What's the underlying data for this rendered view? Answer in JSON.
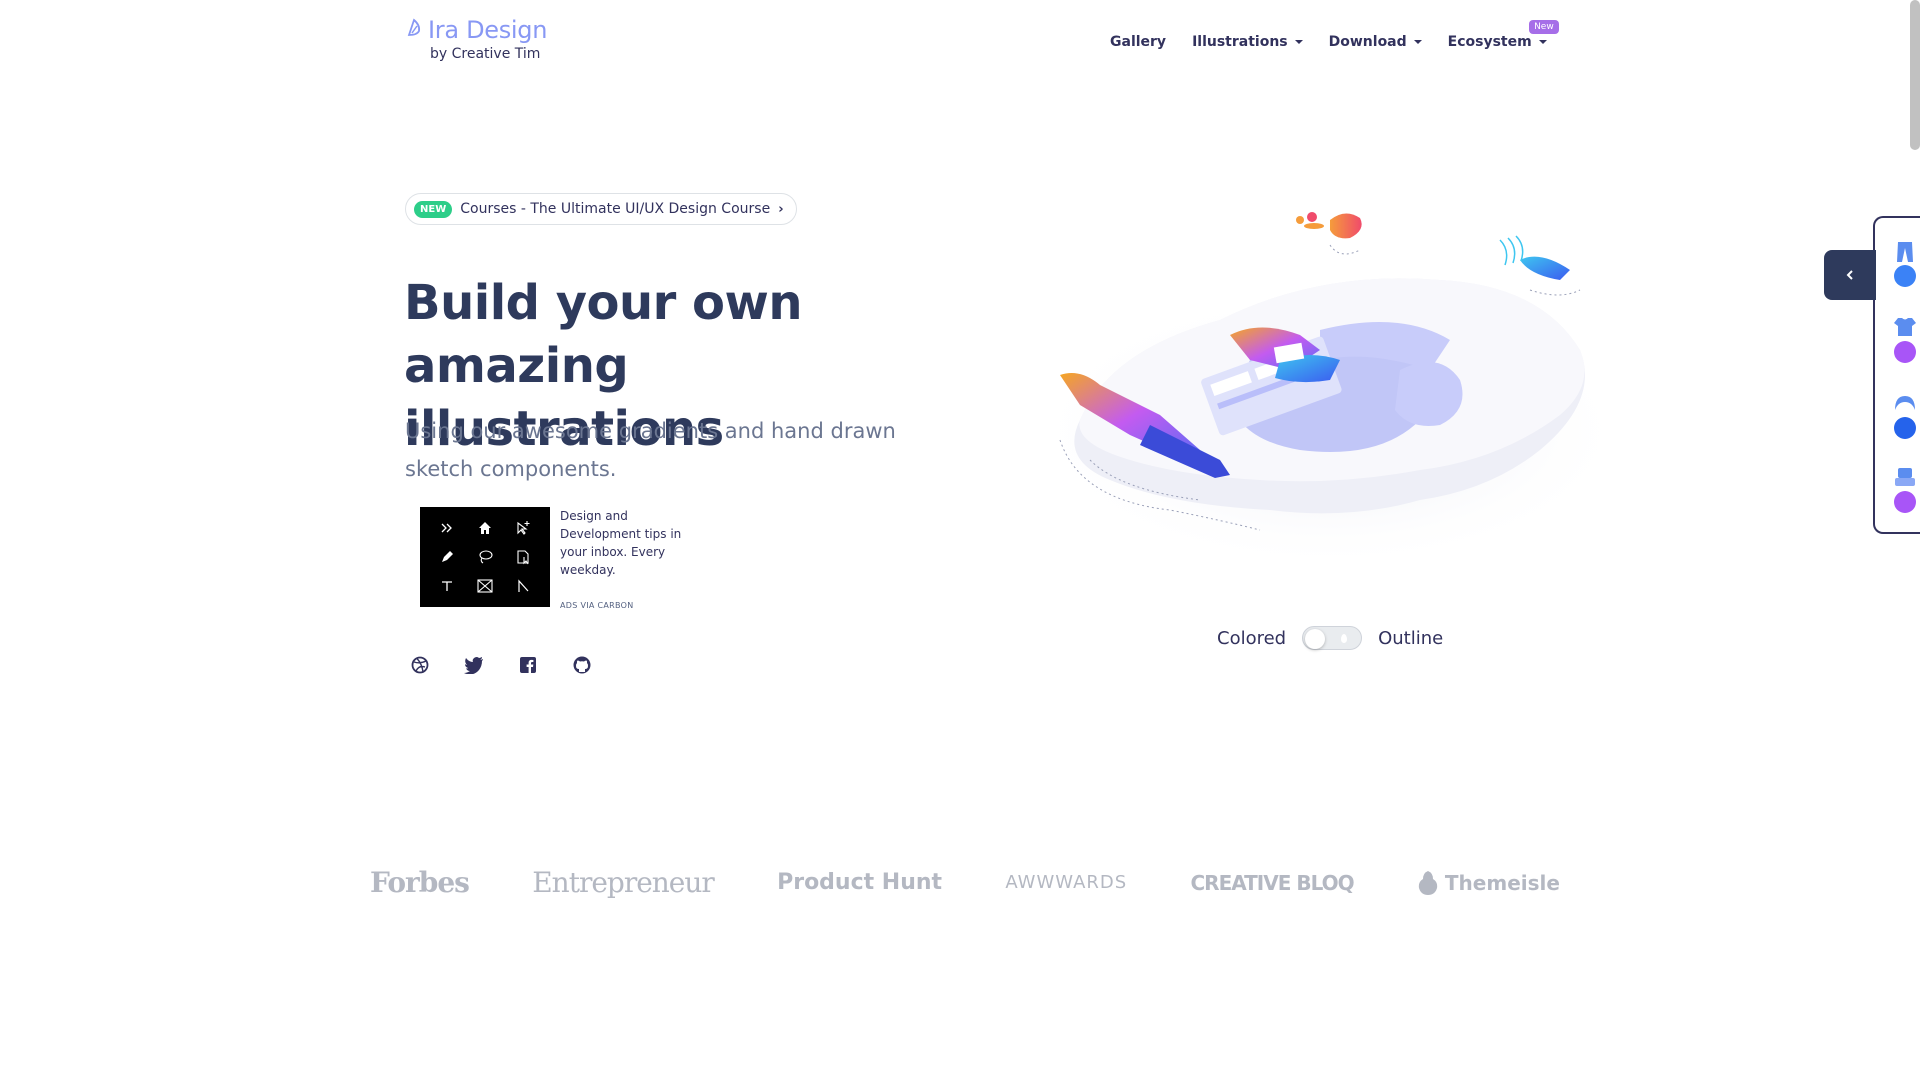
{
  "brand": {
    "title": "Ira Design",
    "subtitle": "by Creative Tim"
  },
  "nav": {
    "items": [
      {
        "label": "Gallery",
        "dropdown": false
      },
      {
        "label": "Illustrations",
        "dropdown": true
      },
      {
        "label": "Download",
        "dropdown": true
      },
      {
        "label": "Ecosystem",
        "dropdown": true,
        "badge": "New"
      }
    ]
  },
  "hero": {
    "pill_badge": "NEW",
    "pill_text": "Courses - The Ultimate UI/UX Design Course",
    "title": "Build your own amazing illustrations",
    "lead": "Using our awesome gradients and hand drawn sketch components."
  },
  "ad": {
    "text": "Design and Development tips in your inbox. Every weekday.",
    "via": "ADS VIA CARBON"
  },
  "social": [
    "dribbble-icon",
    "twitter-icon",
    "facebook-icon",
    "github-icon"
  ],
  "toggle": {
    "left_label": "Colored",
    "right_label": "Outline",
    "checked": false
  },
  "press": {
    "logos": [
      "Forbes",
      "Entrepreneur",
      "Product Hunt",
      "AWWWARDS",
      "CREATIVE BLOQ",
      "Themeisle"
    ]
  },
  "side_panel": {
    "items": [
      "pants-icon",
      "shirt-icon",
      "hair-icon",
      "chair-icon"
    ],
    "colors": [
      "#3b82f6",
      "#a855f7",
      "#2563eb",
      "#a855f7"
    ]
  },
  "colors": {
    "brand": "#8898f4",
    "primary_text": "#32325d",
    "badge_new": "#2dce89",
    "badge_purple": "#a66ee8"
  }
}
